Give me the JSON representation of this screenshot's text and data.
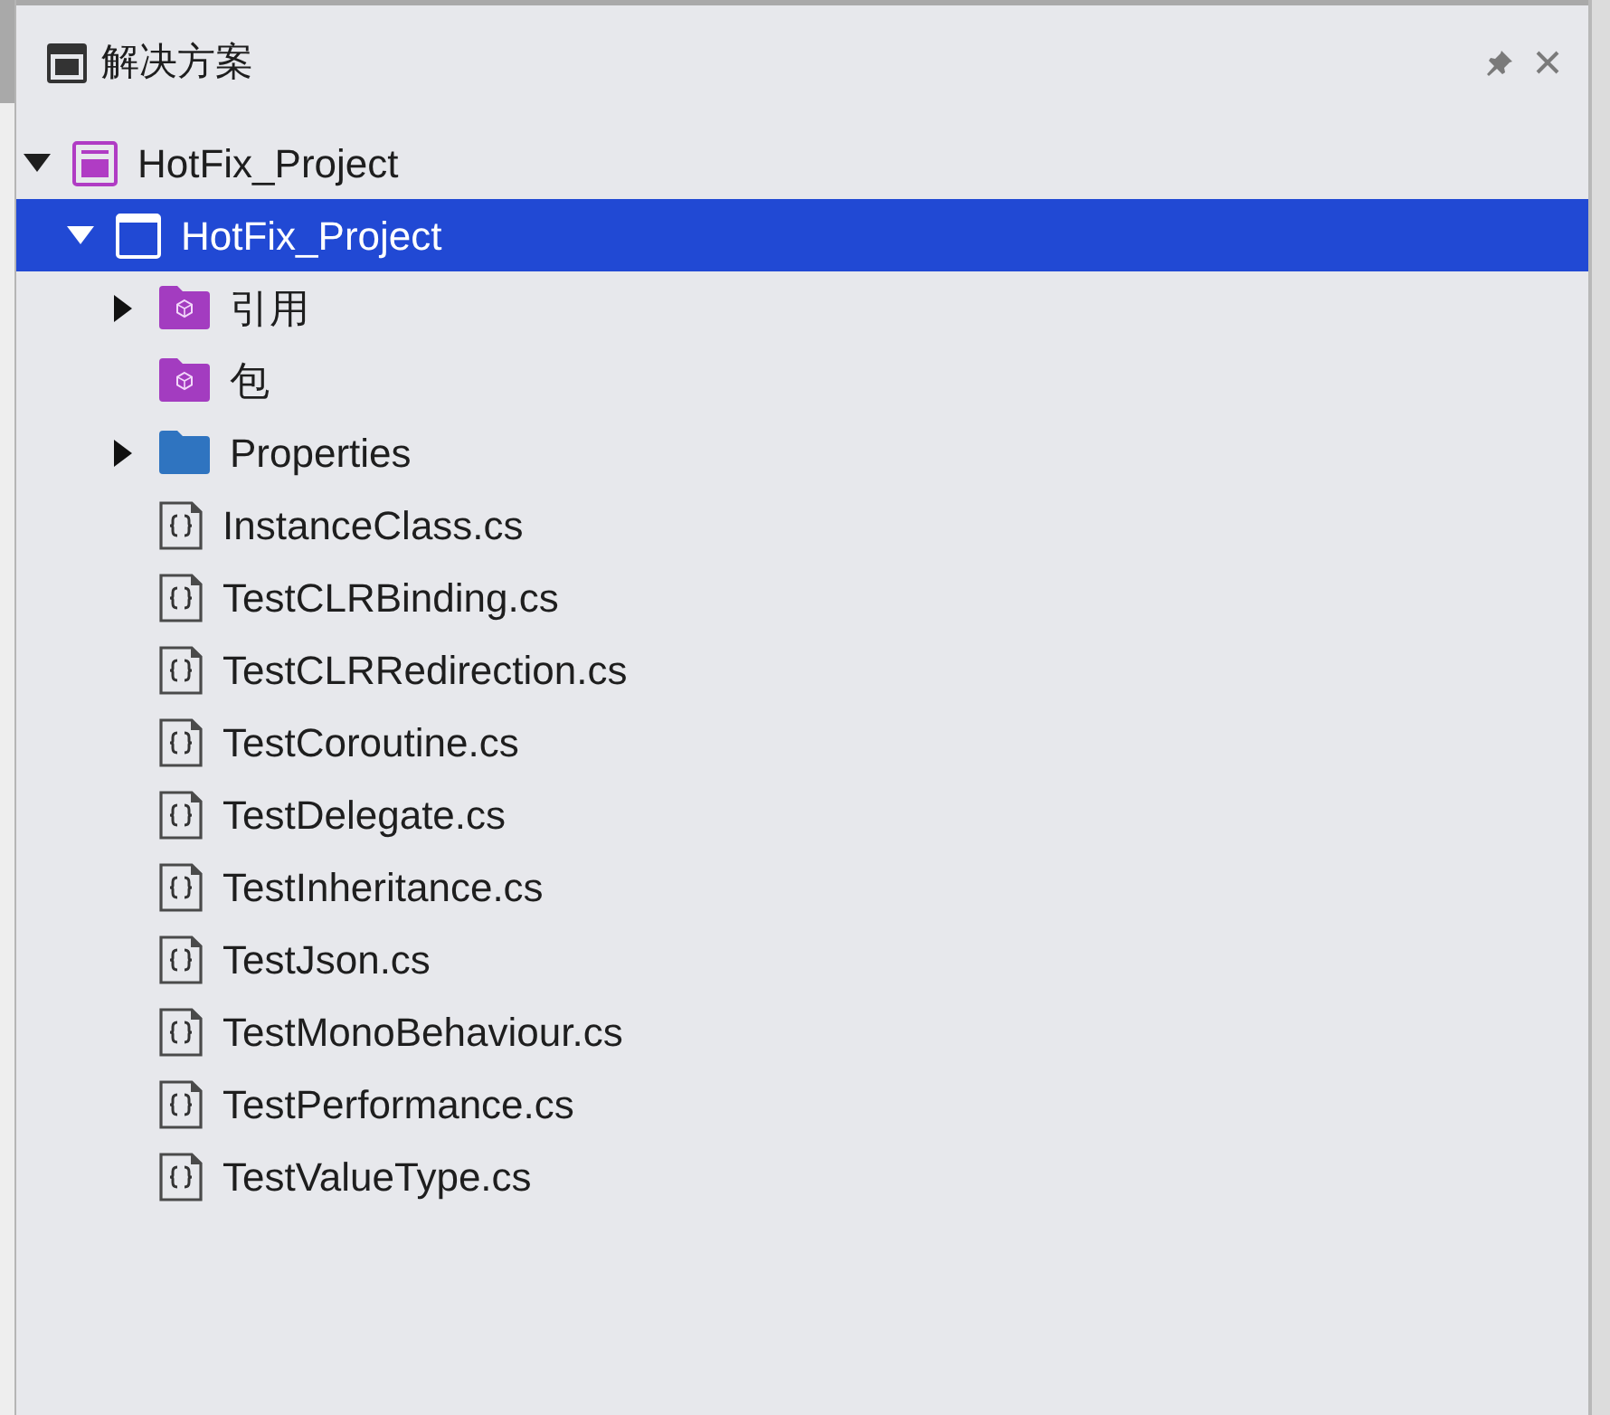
{
  "panel": {
    "title": "解决方案"
  },
  "tree": [
    {
      "label": "HotFix_Project",
      "kind": "solution",
      "expanded": true,
      "selected": false,
      "children": [
        {
          "label": "HotFix_Project",
          "kind": "project",
          "expanded": true,
          "selected": true,
          "children": [
            {
              "label": "引用",
              "kind": "package-folder",
              "expanded": false,
              "selected": false
            },
            {
              "label": "包",
              "kind": "package-folder",
              "selected": false
            },
            {
              "label": "Properties",
              "kind": "folder",
              "expanded": false,
              "selected": false
            },
            {
              "label": "InstanceClass.cs",
              "kind": "code-file",
              "selected": false
            },
            {
              "label": "TestCLRBinding.cs",
              "kind": "code-file",
              "selected": false
            },
            {
              "label": "TestCLRRedirection.cs",
              "kind": "code-file",
              "selected": false
            },
            {
              "label": "TestCoroutine.cs",
              "kind": "code-file",
              "selected": false
            },
            {
              "label": "TestDelegate.cs",
              "kind": "code-file",
              "selected": false
            },
            {
              "label": "TestInheritance.cs",
              "kind": "code-file",
              "selected": false
            },
            {
              "label": "TestJson.cs",
              "kind": "code-file",
              "selected": false
            },
            {
              "label": "TestMonoBehaviour.cs",
              "kind": "code-file",
              "selected": false
            },
            {
              "label": "TestPerformance.cs",
              "kind": "code-file",
              "selected": false
            },
            {
              "label": "TestValueType.cs",
              "kind": "code-file",
              "selected": false
            }
          ]
        }
      ]
    }
  ]
}
